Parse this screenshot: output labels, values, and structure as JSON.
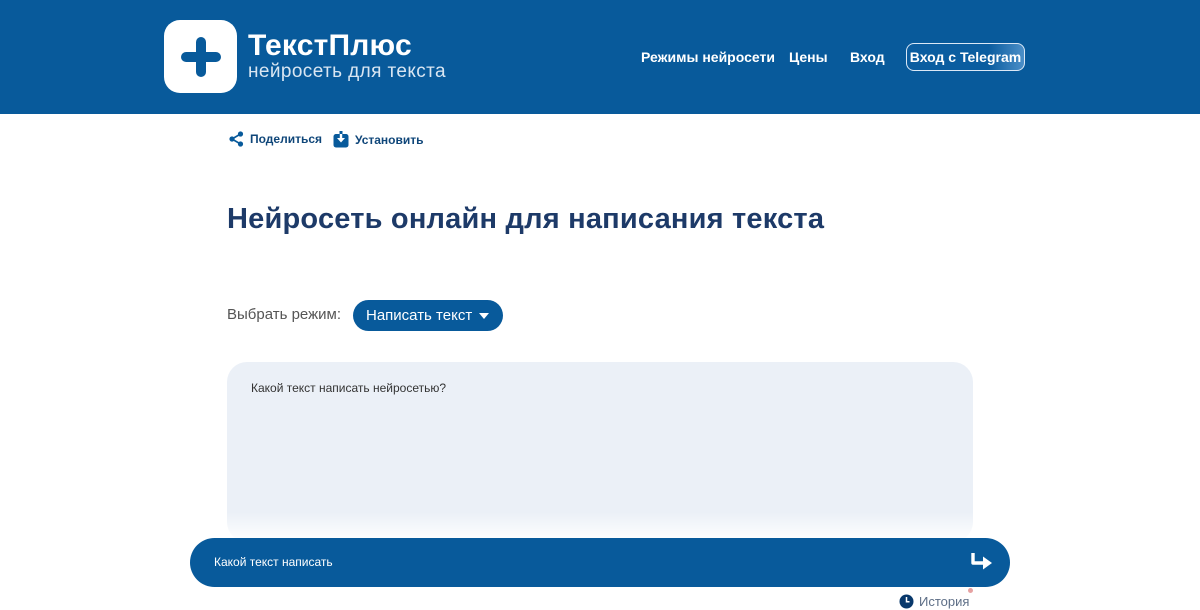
{
  "brand": {
    "title": "ТекстПлюс",
    "subtitle": "нейросеть для текста"
  },
  "nav": {
    "modes": "Режимы нейросети",
    "prices": "Цены",
    "login": "Вход",
    "telegram": "Вход с Telegram"
  },
  "actions": {
    "share": "Поделиться",
    "install": "Установить"
  },
  "main": {
    "title": "Нейросеть онлайн для написания текста",
    "mode_label": "Выбрать режим:",
    "mode_selected": "Написать текст",
    "textarea_placeholder": "Какой текст написать нейросетью?"
  },
  "prompt": {
    "placeholder": "Какой текст написать"
  },
  "history": {
    "label": "История"
  },
  "colors": {
    "brand_blue": "#085A9B",
    "heading": "#1d3a68",
    "textarea_bg": "#ebf0f7"
  }
}
